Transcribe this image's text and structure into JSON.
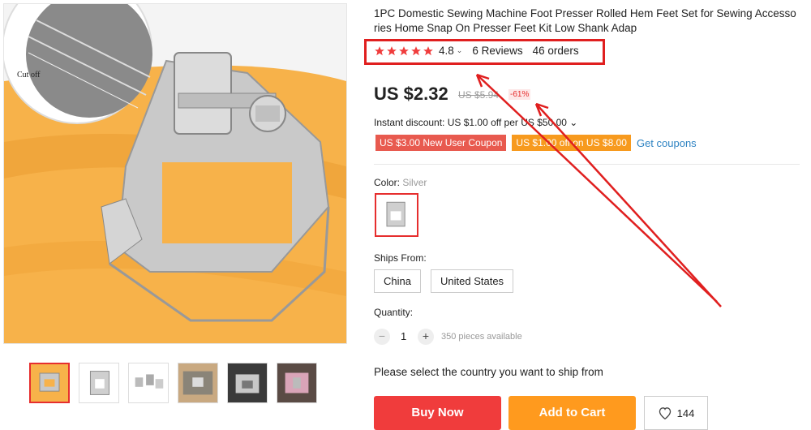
{
  "product": {
    "title": "1PC Domestic Sewing Machine Foot Presser Rolled Hem Feet Set for Sewing Accesso ries Home Snap On Presser Feet Kit Low Shank Adap",
    "image_label": "Cut off"
  },
  "rating": {
    "stars": 5,
    "score": "4.8",
    "caret": "⌄",
    "reviews": "6 Reviews",
    "orders": "46 orders"
  },
  "price": {
    "current": "US $2.32",
    "original": "US $5.94",
    "discount": "-61%"
  },
  "instant_discount": "Instant discount: US $1.00 off per US $50.00 ⌄",
  "coupons": {
    "new_user": "US $3.00 New User Coupon",
    "off": "US $1.00 off on US $8.00",
    "get": "Get coupons"
  },
  "color": {
    "label": "Color:",
    "value": "Silver"
  },
  "ships_from": {
    "label": "Ships From:",
    "options": [
      "China",
      "United States"
    ]
  },
  "quantity": {
    "label": "Quantity:",
    "minus": "−",
    "value": "1",
    "plus": "+",
    "available": "350 pieces available"
  },
  "ship_note": "Please select the country you want to ship from",
  "actions": {
    "buy": "Buy Now",
    "cart": "Add to Cart",
    "wishlist_count": "144"
  },
  "colors": {
    "accent_red": "#e62e2e",
    "buy_red": "#f03c3c",
    "cart_orange": "#ff9a1e",
    "link_blue": "#2e83c2",
    "annotation_red": "#e01f1f"
  },
  "icons": [
    "star-icon",
    "heart-icon",
    "arrow-annotation"
  ]
}
